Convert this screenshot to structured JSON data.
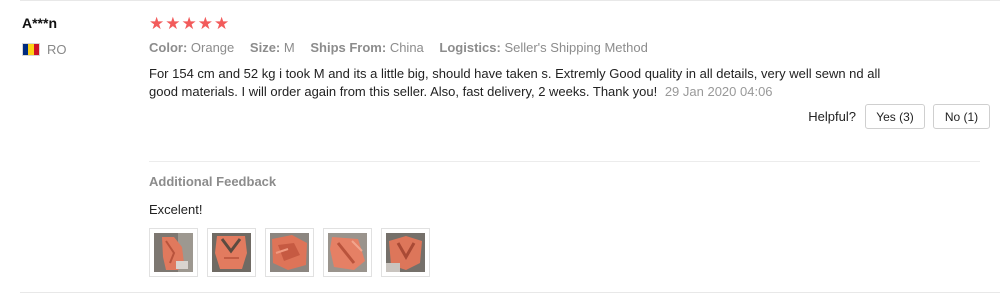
{
  "reviewer": {
    "name": "A***n",
    "country_code": "RO",
    "flag_colors": [
      "#002B7F",
      "#FCD116",
      "#CE1126"
    ]
  },
  "rating": {
    "stars": 5,
    "max": 5,
    "star_color": "#f25b5b"
  },
  "attributes": [
    {
      "label": "Color:",
      "value": "Orange"
    },
    {
      "label": "Size:",
      "value": "M"
    },
    {
      "label": "Ships From:",
      "value": "China"
    },
    {
      "label": "Logistics:",
      "value": "Seller's Shipping Method"
    }
  ],
  "comment": {
    "text": "For 154 cm and 52 kg i took M and its a little big, should have taken s. Extremly Good quality in all details, very well sewn nd all good materials. I will order again from this seller. Also, fast delivery, 2 weeks. Thank you!",
    "date": "29 Jan 2020 04:06"
  },
  "helpful": {
    "label": "Helpful?",
    "yes_label": "Yes (3)",
    "no_label": "No (1)"
  },
  "additional_feedback": {
    "title": "Additional Feedback",
    "text": "Excelent!",
    "photos": [
      "photo-1",
      "photo-2",
      "photo-3",
      "photo-4",
      "photo-5"
    ]
  }
}
